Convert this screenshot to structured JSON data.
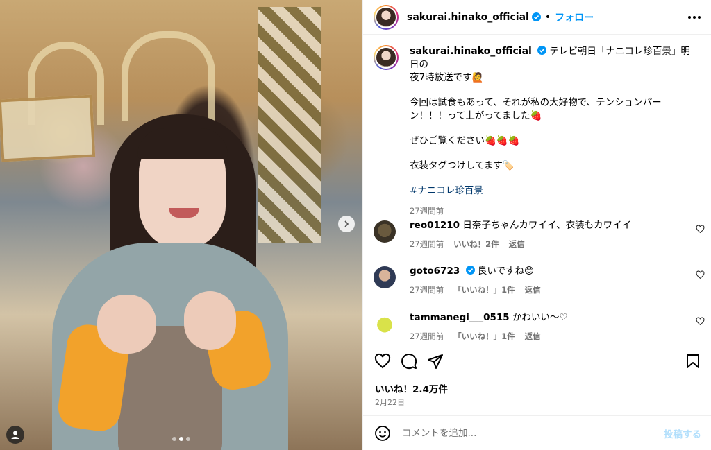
{
  "post": {
    "username": "sakurai.hinako_official",
    "verified": true,
    "follow_label": "フォロー",
    "separator": "•"
  },
  "caption": {
    "lines": [
      "テレビ朝日「ナニコレ珍百景」明日の",
      "夜7時放送です🙋",
      "今回は試食もあって、それが私の大好物で、テンションパー",
      "ン！！！って上がってました🍓",
      "ぜひご覧ください🍓🍓🍓",
      "衣装タグつけしてます🏷️"
    ],
    "hashtag": "#ナニコレ珍百景",
    "time": "27週間前"
  },
  "comments": [
    {
      "user": "reo01210",
      "verified": false,
      "text": "日奈子ちゃんカワイイ、衣装もカワイイ",
      "time": "27週間前",
      "likes": "いいね！2件",
      "reply": "返信"
    },
    {
      "user": "goto6723",
      "verified": true,
      "text": "良いですね😊",
      "time": "27週間前",
      "likes": "「いいね！」1件",
      "reply": "返信"
    },
    {
      "user": "tammanegi___0515",
      "verified": false,
      "text": "かわいい〜♡",
      "time": "27週間前",
      "likes": "「いいね！」1件",
      "reply": "返信"
    }
  ],
  "actions": {
    "likes": "いいね！2.4万件",
    "date": "2月22日"
  },
  "comment_input": {
    "placeholder": "コメントを追加...",
    "post_label": "投稿する"
  },
  "carousel": {
    "slides": 3,
    "active": 1
  },
  "colors": {
    "link": "#0095f6",
    "hashtag": "#00376b",
    "muted": "#737373",
    "post_disabled": "#b2dffc"
  }
}
